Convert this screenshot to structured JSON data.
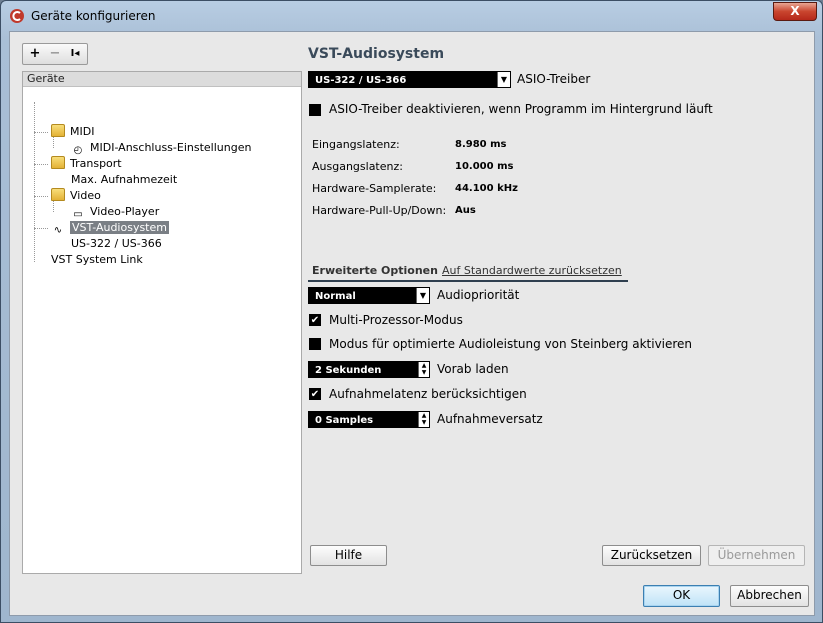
{
  "window": {
    "title": "Geräte konfigurieren",
    "close_label": "X"
  },
  "toolbar": {
    "add": "+",
    "remove": "−",
    "reset": "I◂"
  },
  "tree": {
    "header": "Geräte",
    "items": [
      {
        "label": "MIDI"
      },
      {
        "label": "MIDI-Anschluss-Einstellungen"
      },
      {
        "label": "Transport"
      },
      {
        "label": "Max. Aufnahmezeit"
      },
      {
        "label": "Video"
      },
      {
        "label": "Video-Player"
      },
      {
        "label": "VST-Audiosystem"
      },
      {
        "label": "US-322 / US-366"
      },
      {
        "label": "VST System Link"
      }
    ]
  },
  "settings": {
    "title": "VST-Audiosystem",
    "driver_value": "US-322 / US-366",
    "driver_label": "ASIO-Treiber",
    "deactivate_label": "ASIO-Treiber deaktivieren, wenn Programm im Hintergrund läuft",
    "info": [
      {
        "label": "Eingangslatenz:",
        "value": "8.980 ms"
      },
      {
        "label": "Ausgangslatenz:",
        "value": "10.000 ms"
      },
      {
        "label": "Hardware-Samplerate:",
        "value": "44.100 kHz"
      },
      {
        "label": "Hardware-Pull-Up/Down:",
        "value": "Aus"
      }
    ],
    "tab_active": "Erweiterte Optionen",
    "tab_reset_link": "Auf Standardwerte zurücksetzen",
    "priority_value": "Normal",
    "priority_label": "Audiopriorität",
    "multiproc_label": "Multi-Prozessor-Modus",
    "steinberg_label": "Modus für optimierte Audioleistung von Steinberg aktivieren",
    "preload_value": "2 Sekunden",
    "preload_label": "Vorab laden",
    "latency_label": "Aufnahmelatenz berücksichtigen",
    "offset_value": "0 Samples",
    "offset_label": "Aufnahmeversatz",
    "checkmark": "✔"
  },
  "buttons": {
    "help": "Hilfe",
    "reset": "Zurücksetzen",
    "apply": "Übernehmen",
    "ok": "OK",
    "cancel": "Abbrechen"
  },
  "colors": {
    "accent": "#3c7fb1",
    "close": "#c9452e",
    "title": "#3a4a5a"
  }
}
